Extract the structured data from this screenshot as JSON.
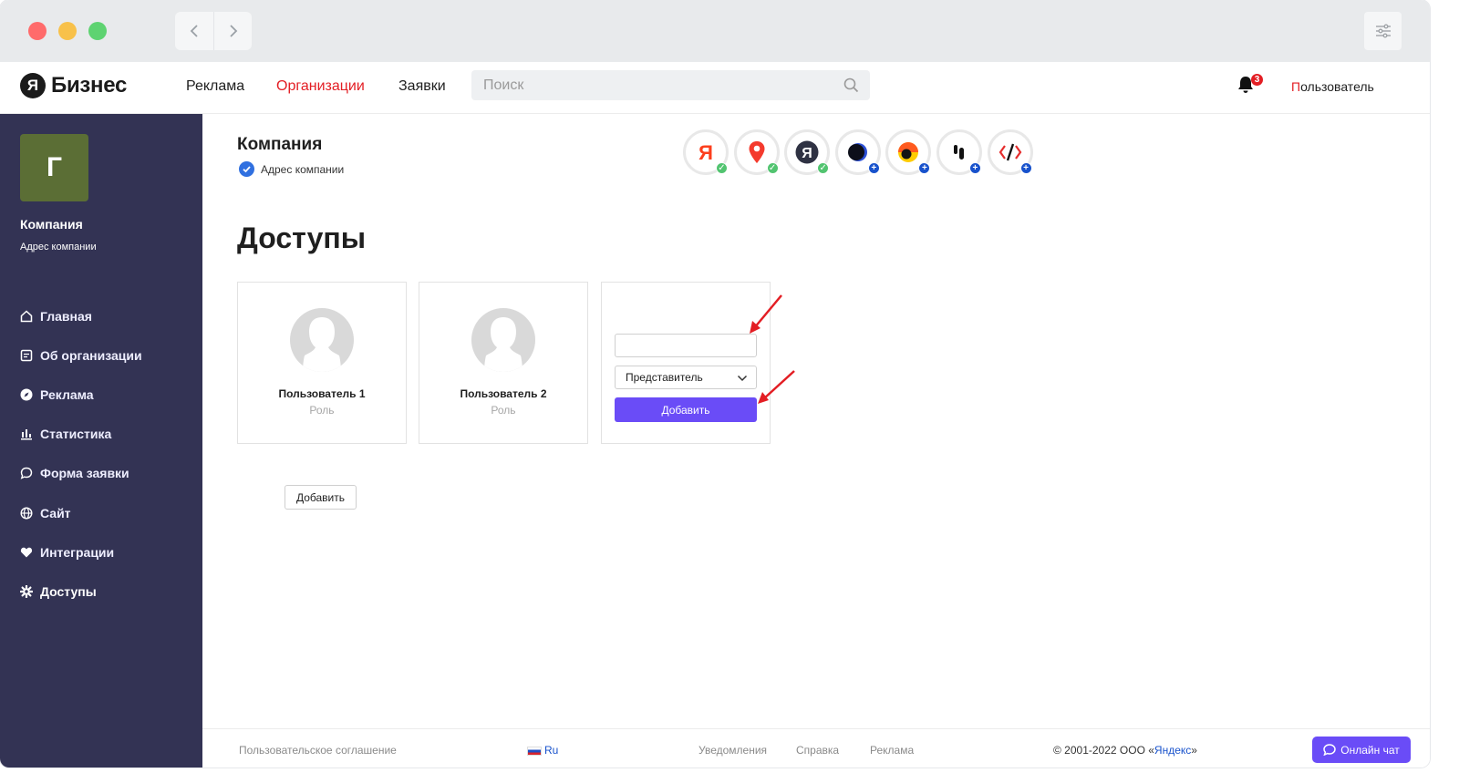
{
  "header": {
    "logo_letter": "Я",
    "logo_text": "Бизнес",
    "nav": [
      {
        "label": "Реклама",
        "active": false
      },
      {
        "label": "Организации",
        "active": true
      },
      {
        "label": "Заявки",
        "active": false
      }
    ],
    "search_placeholder": "Поиск",
    "notifications_count": "3",
    "user_first_letter": "П",
    "user_rest": "ользователь"
  },
  "sidebar": {
    "avatar_letter": "Г",
    "company_name": "Компания",
    "company_address": "Адрес компании",
    "items": [
      {
        "label": "Главная",
        "icon": "home-icon"
      },
      {
        "label": "Об организации",
        "icon": "document-icon"
      },
      {
        "label": "Реклама",
        "icon": "compass-icon"
      },
      {
        "label": "Статистика",
        "icon": "bar-chart-icon"
      },
      {
        "label": "Форма заявки",
        "icon": "chat-bubble-icon"
      },
      {
        "label": "Сайт",
        "icon": "globe-icon"
      },
      {
        "label": "Интеграции",
        "icon": "heart-icon"
      },
      {
        "label": "Доступы",
        "icon": "gear-icon",
        "active": true
      }
    ]
  },
  "main": {
    "company_title": "Компания",
    "company_address": "Адрес компании",
    "services": [
      {
        "icon": "yandex-ya-icon",
        "status": "connected"
      },
      {
        "icon": "maps-pin-icon",
        "status": "connected"
      },
      {
        "icon": "yandex-circle-icon",
        "status": "connected"
      },
      {
        "icon": "dark-moon-icon",
        "status": "add"
      },
      {
        "icon": "orange-ball-icon",
        "status": "add"
      },
      {
        "icon": "quote-icon",
        "status": "add"
      },
      {
        "icon": "code-tools-icon",
        "status": "add"
      }
    ],
    "page_title": "Доступы",
    "users": [
      {
        "name": "Пользователь 1",
        "role": "Роль"
      },
      {
        "name": "Пользователь 2",
        "role": "Роль"
      }
    ],
    "new_user": {
      "input_value": "",
      "role_selected": "Представитель",
      "add_label": "Добавить"
    },
    "add_more_label": "Добавить"
  },
  "footer": {
    "agreement": "Пользовательское соглашение",
    "lang": "Ru",
    "links": [
      "Уведомления",
      "Справка",
      "Реклама"
    ],
    "copyright_prefix": "© 2001-2022 ООО «",
    "copyright_link": "Яндекс",
    "copyright_suffix": "»",
    "chat_label": "Онлайн чат"
  },
  "colors": {
    "accent": "#6a4cf7",
    "sidebar": "#333354",
    "active_nav": "#e31e24",
    "avatar": "#5b6e35"
  }
}
